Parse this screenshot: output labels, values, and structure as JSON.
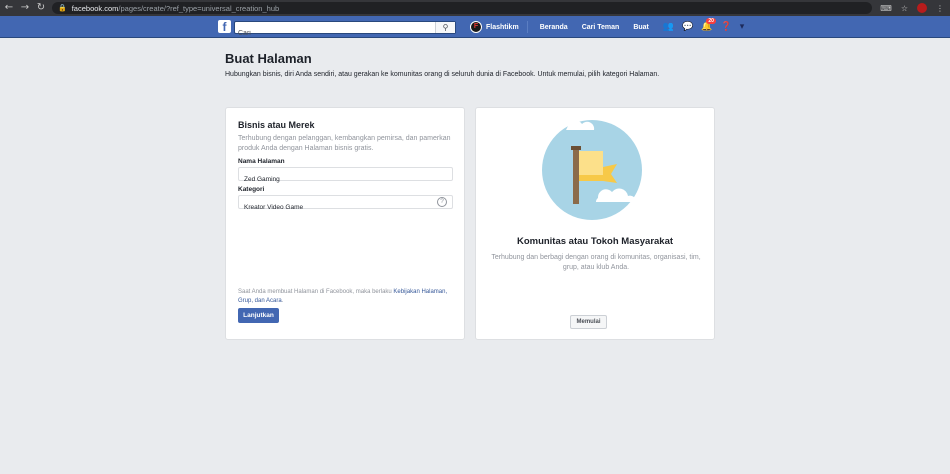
{
  "browser": {
    "url_host": "facebook.com",
    "url_path": "/pages/create/?ref_type=universal_creation_hub",
    "icons": [
      "back-icon",
      "forward-icon",
      "reload-icon",
      "lock-icon",
      "translate-icon",
      "star-icon",
      "profile-icon",
      "menu-icon"
    ],
    "profile_letter": "F"
  },
  "header": {
    "search_placeholder": "Cari",
    "user_name": "Flashtikm",
    "user_initial": "F",
    "nav": {
      "home": "Beranda",
      "find_friends": "Cari Teman",
      "create": "Buat"
    },
    "notification_count": "20",
    "colors": {
      "bar": "#4267b2"
    }
  },
  "page": {
    "title": "Buat Halaman",
    "description": "Hubungkan bisnis, diri Anda sendiri, atau gerakan ke komunitas orang di seluruh dunia di Facebook. Untuk memulai, pilih kategori Halaman."
  },
  "business_card": {
    "title": "Bisnis atau Merek",
    "description": "Terhubung dengan pelanggan, kembangkan pemirsa, dan pamerkan produk Anda dengan Halaman bisnis gratis.",
    "page_name_label": "Nama Halaman",
    "page_name_value": "Zed Gaming",
    "category_label": "Kategori",
    "category_value": "Kreator Video Game",
    "help_symbol": "?",
    "terms_prefix": "Saat Anda membuat Halaman di Facebook, maka berlaku ",
    "terms_link": "Kebijakan Halaman, Grup, dan Acara",
    "terms_suffix": ".",
    "continue_button": "Lanjutkan"
  },
  "community_card": {
    "title": "Komunitas atau Tokoh Masyarakat",
    "description": "Terhubung dan berbagi dengan orang di komunitas, organisasi, tim, grup, atau klub Anda.",
    "start_button": "Memulai"
  }
}
